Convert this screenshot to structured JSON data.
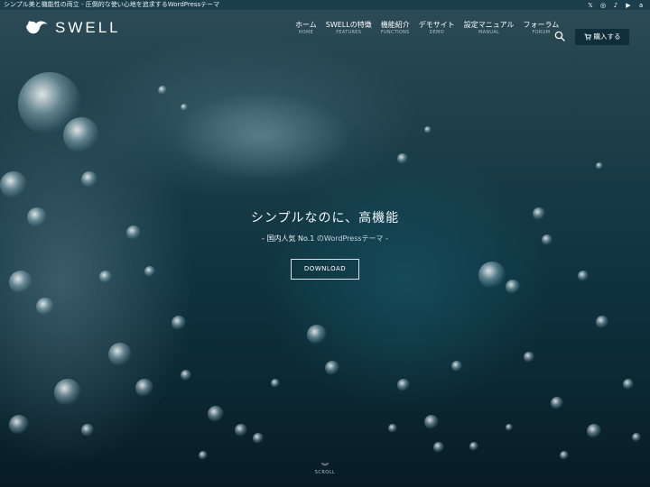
{
  "topbar": {
    "tagline": "シンプル美と機能性の両立 - 圧倒的な使い心地を追求するWordPressテーマ",
    "social": [
      {
        "icon": "x-icon",
        "glyph": "𝕏"
      },
      {
        "icon": "instagram-icon",
        "glyph": "◎"
      },
      {
        "icon": "tiktok-icon",
        "glyph": "♪"
      },
      {
        "icon": "youtube-icon",
        "glyph": "▶"
      },
      {
        "icon": "amazon-icon",
        "glyph": "a"
      }
    ]
  },
  "header": {
    "logo_text": "SWELL",
    "nav": [
      {
        "jp": "ホーム",
        "en": "HOME"
      },
      {
        "jp": "SWELLの特徴",
        "en": "FEATURES"
      },
      {
        "jp": "機能紹介",
        "en": "FUNCTIONS"
      },
      {
        "jp": "デモサイト",
        "en": "DEMO"
      },
      {
        "jp": "設定マニュアル",
        "en": "MANUAL"
      },
      {
        "jp": "フォーラム",
        "en": "FORUM"
      }
    ],
    "buy_label": "購入する",
    "buy_icon": "cart-icon",
    "search_icon": "search-icon"
  },
  "hero": {
    "title": "シンプルなのに、高機能",
    "sub_dash_left": "- ",
    "sub_strong": "国内人気 No.1",
    "sub_rest": "のWordPressテーマ",
    "sub_dash_right": " -",
    "download_label": "DOWNLOAD",
    "scroll_label": "SCROLL"
  },
  "colors": {
    "topbar_bg": "#1c3f4d",
    "buy_button_bg": "#0f2e3a",
    "hero_base": "#0f3441"
  }
}
